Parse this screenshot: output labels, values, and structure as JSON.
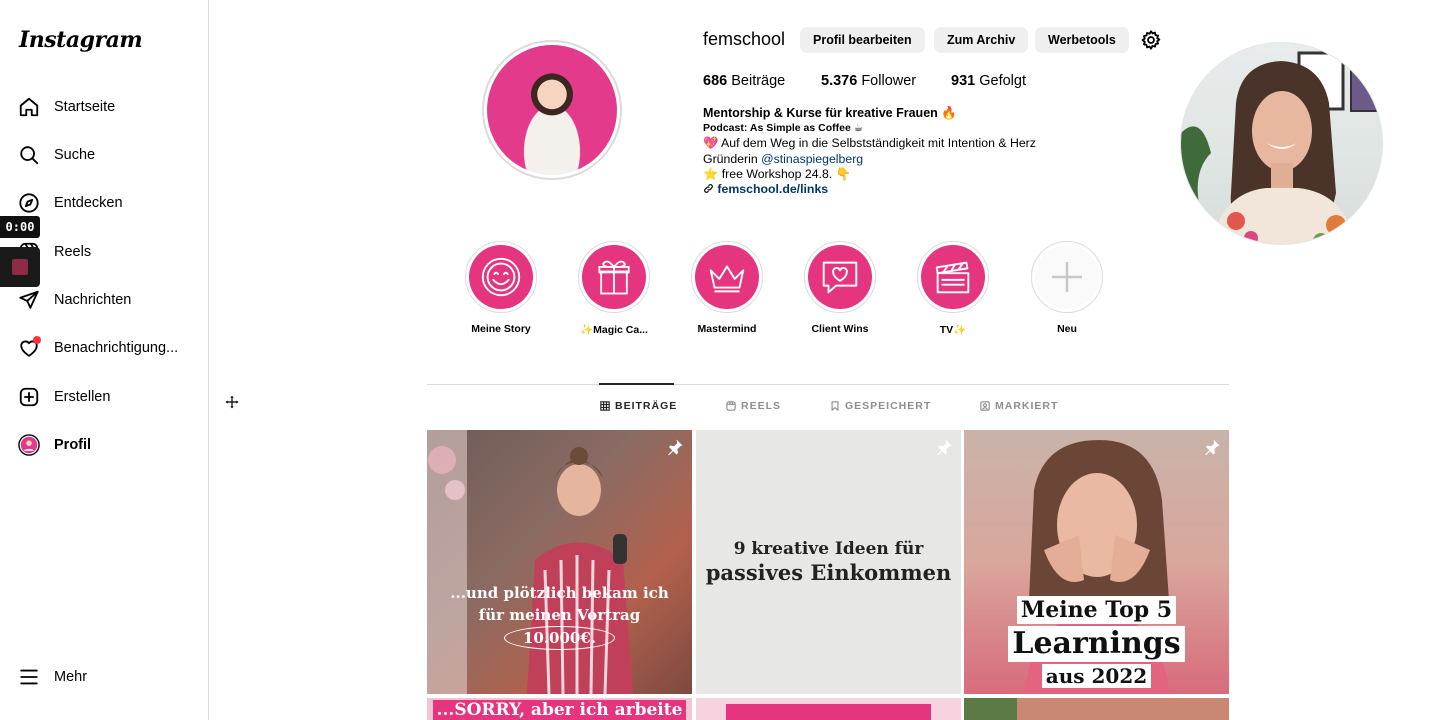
{
  "app": {
    "logo": "Instagram"
  },
  "sidebar": {
    "items": [
      {
        "label": "Startseite",
        "icon": "home-icon"
      },
      {
        "label": "Suche",
        "icon": "search-icon"
      },
      {
        "label": "Entdecken",
        "icon": "compass-icon"
      },
      {
        "label": "Reels",
        "icon": "reels-icon"
      },
      {
        "label": "Nachrichten",
        "icon": "send-icon"
      },
      {
        "label": "Benachrichtigung...",
        "icon": "heart-icon"
      },
      {
        "label": "Erstellen",
        "icon": "plus-square-icon"
      },
      {
        "label": "Profil",
        "icon": "avatar"
      }
    ],
    "more": {
      "label": "Mehr",
      "icon": "menu-icon"
    }
  },
  "recorder": {
    "time": "0:00"
  },
  "profile": {
    "username": "femschool",
    "buttons": {
      "edit": "Profil bearbeiten",
      "archive": "Zum Archiv",
      "tools": "Werbetools"
    },
    "stats": {
      "posts_count": "686",
      "posts_label": "Beiträge",
      "followers_count": "5.376",
      "followers_label": "Follower",
      "following_count": "931",
      "following_label": "Gefolgt"
    },
    "bio": {
      "name": "Mentorship & Kurse für kreative Frauen 🔥",
      "line1": "Podcast: As Simple as Coffee ☕",
      "line2": "💖 Auf dem Weg in die Selbstständigkeit mit Intention & Herz",
      "line3_prefix": "Gründerin ",
      "line3_mention": "@stinaspiegelberg",
      "line4": "⭐ free Workshop 24.8. 👇",
      "link": "femschool.de/links"
    }
  },
  "highlights": [
    {
      "label": "Meine Story",
      "icon": "smiley-icon"
    },
    {
      "label": "✨Magic Ca...",
      "icon": "gift-icon"
    },
    {
      "label": "Mastermind",
      "icon": "crown-icon"
    },
    {
      "label": "Client Wins",
      "icon": "chat-heart-icon"
    },
    {
      "label": "TV✨",
      "icon": "clapperboard-icon"
    },
    {
      "label": "Neu",
      "icon": "plus-icon"
    }
  ],
  "tabs": [
    {
      "label": "BEITRÄGE",
      "icon": "grid-icon",
      "active": true
    },
    {
      "label": "REELS",
      "icon": "reels-icon"
    },
    {
      "label": "GESPEICHERT",
      "icon": "bookmark-icon"
    },
    {
      "label": "MARKIERT",
      "icon": "tagged-icon"
    }
  ],
  "posts": [
    {
      "text": "...und plötzlich bekam ich für meinen Vortrag 10.000€.",
      "line1": "...und plötzlich bekam ich",
      "line2": "für meinen Vortrag",
      "line3": "10.000€."
    },
    {
      "text": "9 kreative Ideen für passives Einkommen",
      "line1": "9 kreative Ideen für",
      "line2": "passives Einkommen"
    },
    {
      "text": "Meine Top 5 Learnings aus 2022",
      "line1": "Meine Top 5",
      "line2": "Learnings",
      "line3": "aus 2022"
    },
    {
      "text": "SORRY, aber ich arbeite",
      "line1": "...SORRY, aber ich arbeite"
    }
  ],
  "colors": {
    "accent": "#e5357f",
    "link": "#00376b",
    "border": "#dbdbdb",
    "notification_dot": "#ff3040"
  }
}
